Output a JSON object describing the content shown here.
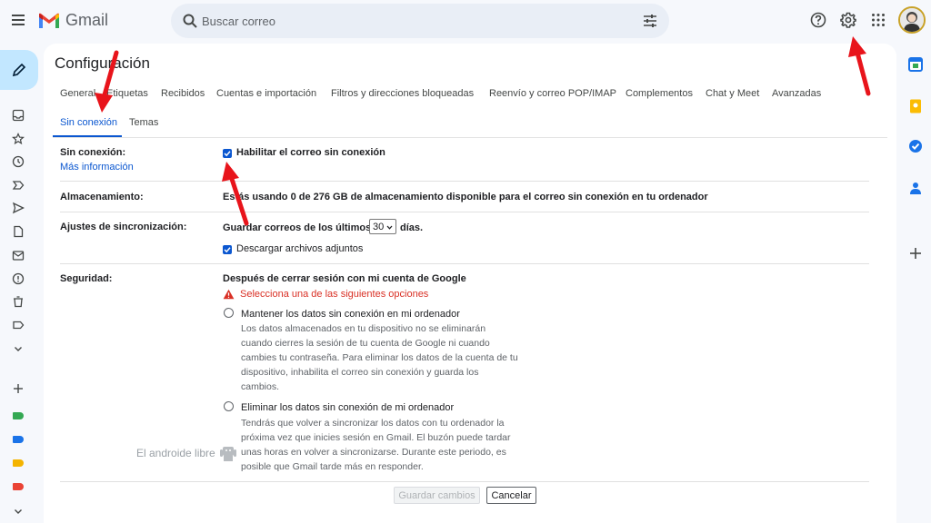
{
  "app": {
    "name": "Gmail"
  },
  "search": {
    "placeholder": "Buscar correo"
  },
  "page": {
    "title": "Configuración"
  },
  "tabs": [
    {
      "label": "General"
    },
    {
      "label": "Etiquetas"
    },
    {
      "label": "Recibidos"
    },
    {
      "label": "Cuentas e importación"
    },
    {
      "label": "Filtros y direcciones bloqueadas"
    },
    {
      "label": "Reenvío y correo POP/IMAP"
    },
    {
      "label": "Complementos"
    },
    {
      "label": "Chat y Meet"
    },
    {
      "label": "Avanzadas"
    },
    {
      "label": "Sin conexión",
      "active": true
    },
    {
      "label": "Temas"
    }
  ],
  "offline": {
    "label": "Sin conexión:",
    "more_info": "Más información",
    "enable_label": "Habilitar el correo sin conexión",
    "enabled": true
  },
  "storage": {
    "label": "Almacenamiento:",
    "text": "Estás usando 0 de 276 GB de almacenamiento disponible para el correo sin conexión en tu ordenador"
  },
  "sync": {
    "label": "Ajustes de sincronización:",
    "prefix": "Guardar correos de los últimos",
    "days_value": "30",
    "suffix": "días.",
    "attachments_label": "Descargar archivos adjuntos",
    "attachments_checked": true
  },
  "security": {
    "label": "Seguridad:",
    "heading": "Después de cerrar sesión con mi cuenta de Google",
    "warning": "Selecciona una de las siguientes opciones",
    "option_keep": {
      "title": "Mantener los datos sin conexión en mi ordenador",
      "lines": [
        "Los datos almacenados en tu dispositivo no se eliminarán",
        "cuando cierres la sesión de tu cuenta de Google ni cuando",
        "cambies tu contraseña. Para eliminar los datos de la cuenta de tu",
        "dispositivo, inhabilita el correo sin conexión y guarda los",
        "cambios."
      ]
    },
    "option_remove": {
      "title": "Eliminar los datos sin conexión de mi ordenador",
      "lines": [
        "Tendrás que volver a sincronizar los datos con tu ordenador la",
        "próxima vez que inicies sesión en Gmail. El buzón puede tardar",
        "unas horas en volver a sincronizarse. Durante este periodo, es",
        "posible que Gmail tarde más en responder."
      ]
    }
  },
  "buttons": {
    "save": "Guardar cambios",
    "cancel": "Cancelar"
  },
  "watermark": "El androide libre",
  "colors": {
    "accent": "#0b57d0",
    "compose_bg": "#c2e7ff",
    "warning": "#d93025",
    "annotation_arrow": "#e8141b",
    "label_green": "#34a853",
    "label_blue": "#1a73e8",
    "label_yellow": "#f4b400",
    "label_red": "#ea4335"
  },
  "icons": {
    "top": [
      "menu-icon",
      "gmail-logo",
      "search-icon",
      "tune-icon",
      "help-icon",
      "settings-icon",
      "apps-grid-icon"
    ],
    "rail": [
      "pencil-icon",
      "inbox-icon",
      "star-icon",
      "clock-icon",
      "important-icon",
      "send-icon",
      "draft-icon",
      "mail-icon",
      "spam-icon",
      "trash-icon",
      "label-icon",
      "chevron-down-icon"
    ],
    "side": [
      "calendar-icon",
      "keep-icon",
      "tasks-icon",
      "contacts-icon",
      "plus-icon"
    ]
  }
}
